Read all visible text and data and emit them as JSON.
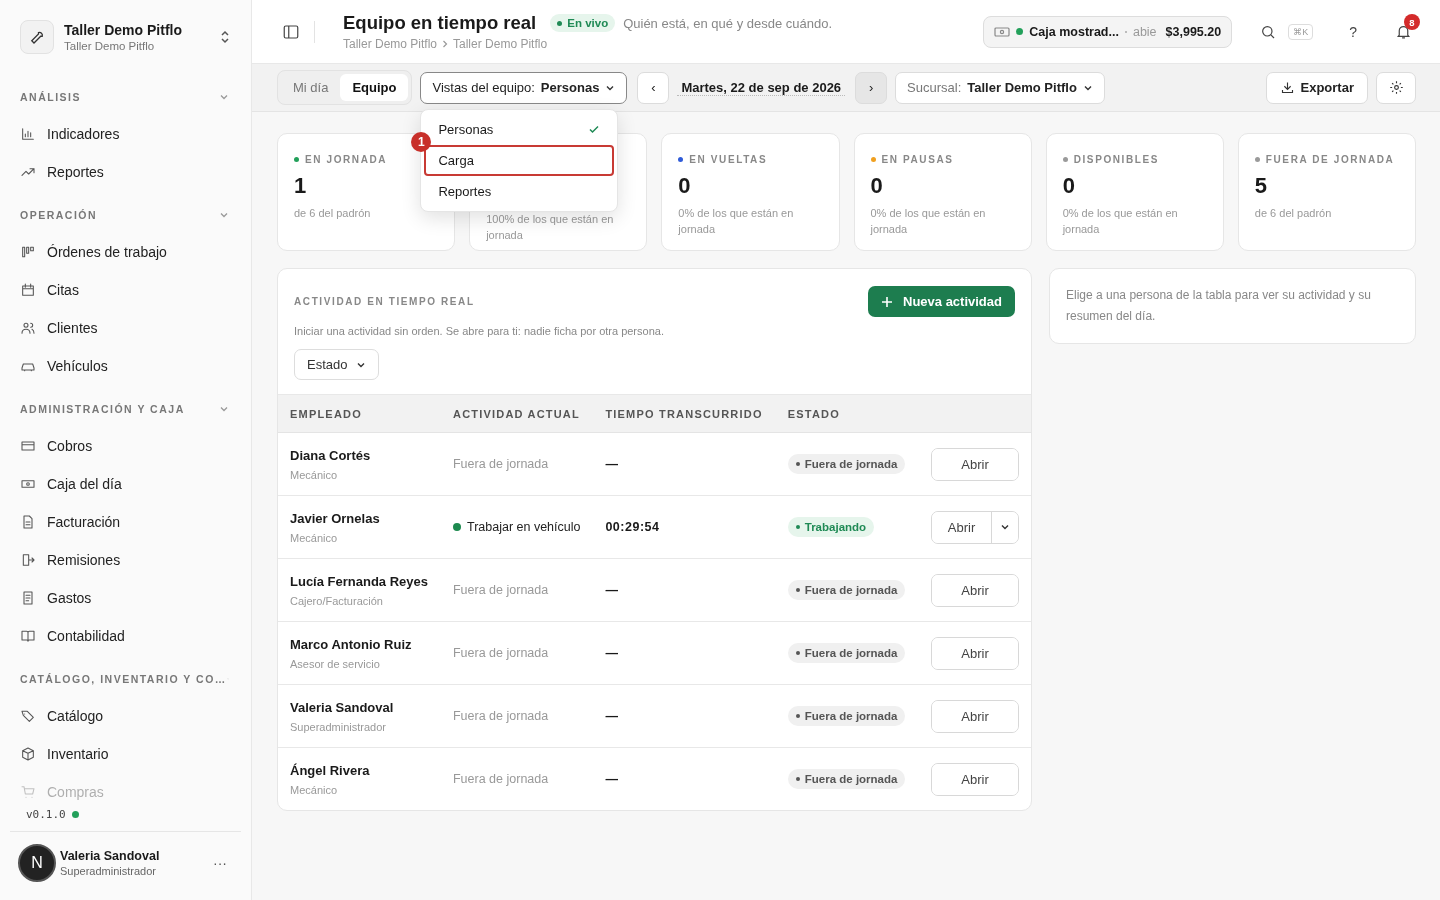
{
  "workspace": {
    "name": "Taller Demo Pitflo",
    "subtitle": "Taller Demo Pitflo"
  },
  "sidebar": {
    "sections": [
      {
        "title": "ANÁLISIS",
        "expanded": true,
        "items": [
          {
            "label": "Indicadores",
            "faded": false
          },
          {
            "label": "Reportes",
            "faded": false
          }
        ]
      },
      {
        "title": "OPERACIÓN",
        "expanded": true,
        "items": [
          {
            "label": "Órdenes de trabajo",
            "faded": false
          },
          {
            "label": "Citas",
            "faded": false
          },
          {
            "label": "Clientes",
            "faded": false
          },
          {
            "label": "Vehículos",
            "faded": false
          }
        ]
      },
      {
        "title": "ADMINISTRACIÓN Y CAJA",
        "expanded": true,
        "items": [
          {
            "label": "Cobros",
            "faded": false
          },
          {
            "label": "Caja del día",
            "faded": false
          },
          {
            "label": "Facturación",
            "faded": false
          },
          {
            "label": "Remisiones",
            "faded": false
          },
          {
            "label": "Gastos",
            "faded": false
          },
          {
            "label": "Contabilidad",
            "faded": false
          }
        ]
      },
      {
        "title": "CATÁLOGO, INVENTARIO Y CO…",
        "expanded": true,
        "items": [
          {
            "label": "Catálogo",
            "faded": false
          },
          {
            "label": "Inventario",
            "faded": false
          },
          {
            "label": "Compras",
            "faded": true
          }
        ]
      }
    ],
    "version": "v0.1.0",
    "user": {
      "initial": "N",
      "name": "Valeria Sandoval",
      "role": "Superadministrador",
      "menu": "···"
    }
  },
  "header": {
    "title": "Equipo en tiempo real",
    "live_badge": "En vivo",
    "subtitle": "Quién está, en qué y desde cuándo.",
    "breadcrumb": [
      "Taller Demo Pitflo",
      "Taller Demo Pitflo"
    ],
    "cash": {
      "name": "Caja mostrad...",
      "status": "abie",
      "amount": "$3,995.20"
    },
    "shortcut": "⌘K",
    "help": "?",
    "notifications": "8"
  },
  "toolbar": {
    "tabs": [
      {
        "label": "Mi día",
        "selected": false
      },
      {
        "label": "Equipo",
        "selected": true
      }
    ],
    "view": {
      "label": "Vistas del equipo:",
      "value": "Personas"
    },
    "prev": "‹",
    "date": "Martes, 22 de sep de 2026",
    "next": "›",
    "branch": {
      "label": "Sucursal:",
      "value": "Taller Demo Pitflo"
    },
    "export": "Exportar"
  },
  "view_menu": [
    {
      "label": "Personas",
      "selected": true,
      "highlighted": false
    },
    {
      "label": "Carga",
      "selected": false,
      "highlighted": true,
      "marker": "1"
    },
    {
      "label": "Reportes",
      "selected": false,
      "highlighted": false
    }
  ],
  "stats": [
    {
      "label": "EN JORNADA",
      "color": "#22a05a",
      "value": "1",
      "note": "de 6 del padrón"
    },
    {
      "note": "100% de los que están en jornada"
    },
    {
      "label": "EN VUELTAS",
      "color": "#2f5bd8",
      "value": "0",
      "note": "0% de los que están en jornada"
    },
    {
      "label": "EN PAUSAS",
      "color": "#f0a020",
      "value": "0",
      "note": "0% de los que están en jornada"
    },
    {
      "label": "DISPONIBLES",
      "color": "#9a9a9a",
      "value": "0",
      "note": "0% de los que están en jornada"
    },
    {
      "label": "FUERA DE JORNADA",
      "color": "#9a9a9a",
      "value": "5",
      "note": "de 6 del padrón"
    }
  ],
  "activity": {
    "title": "ACTIVIDAD EN TIEMPO REAL",
    "new_button": "Nueva actividad",
    "description": "Iniciar una actividad sin orden. Se abre para ti: nadie ficha por otra persona.",
    "filter": "Estado",
    "columns": [
      "EMPLEADO",
      "ACTIVIDAD ACTUAL",
      "TIEMPO TRANSCURRIDO",
      "ESTADO"
    ],
    "rows": [
      {
        "name": "Diana Cortés",
        "role": "Mecánico",
        "activity": "Fuera de jornada",
        "elapsed": "—",
        "status": {
          "kind": "off",
          "label": "Fuera de jornada"
        },
        "action": "Abrir",
        "has_menu": false
      },
      {
        "name": "Javier Ornelas",
        "role": "Mecánico",
        "activity": "Trabajar en vehículo",
        "elapsed": "00:29:54",
        "status": {
          "kind": "working",
          "label": "Trabajando"
        },
        "action": "Abrir",
        "has_menu": true
      },
      {
        "name": "Lucía Fernanda Reyes",
        "role": "Cajero/Facturación",
        "activity": "Fuera de jornada",
        "elapsed": "—",
        "status": {
          "kind": "off",
          "label": "Fuera de jornada"
        },
        "action": "Abrir",
        "has_menu": false
      },
      {
        "name": "Marco Antonio Ruiz",
        "role": "Asesor de servicio",
        "activity": "Fuera de jornada",
        "elapsed": "—",
        "status": {
          "kind": "off",
          "label": "Fuera de jornada"
        },
        "action": "Abrir",
        "has_menu": false
      },
      {
        "name": "Valeria Sandoval",
        "role": "Superadministrador",
        "activity": "Fuera de jornada",
        "elapsed": "—",
        "status": {
          "kind": "off",
          "label": "Fuera de jornada"
        },
        "action": "Abrir",
        "has_menu": false
      },
      {
        "name": "Ángel Rivera",
        "role": "Mecánico",
        "activity": "Fuera de jornada",
        "elapsed": "—",
        "status": {
          "kind": "off",
          "label": "Fuera de jornada"
        },
        "action": "Abrir",
        "has_menu": false
      }
    ]
  },
  "detail": {
    "hint": "Elige a una persona de la tabla para ver su actividad y su resumen del día."
  }
}
